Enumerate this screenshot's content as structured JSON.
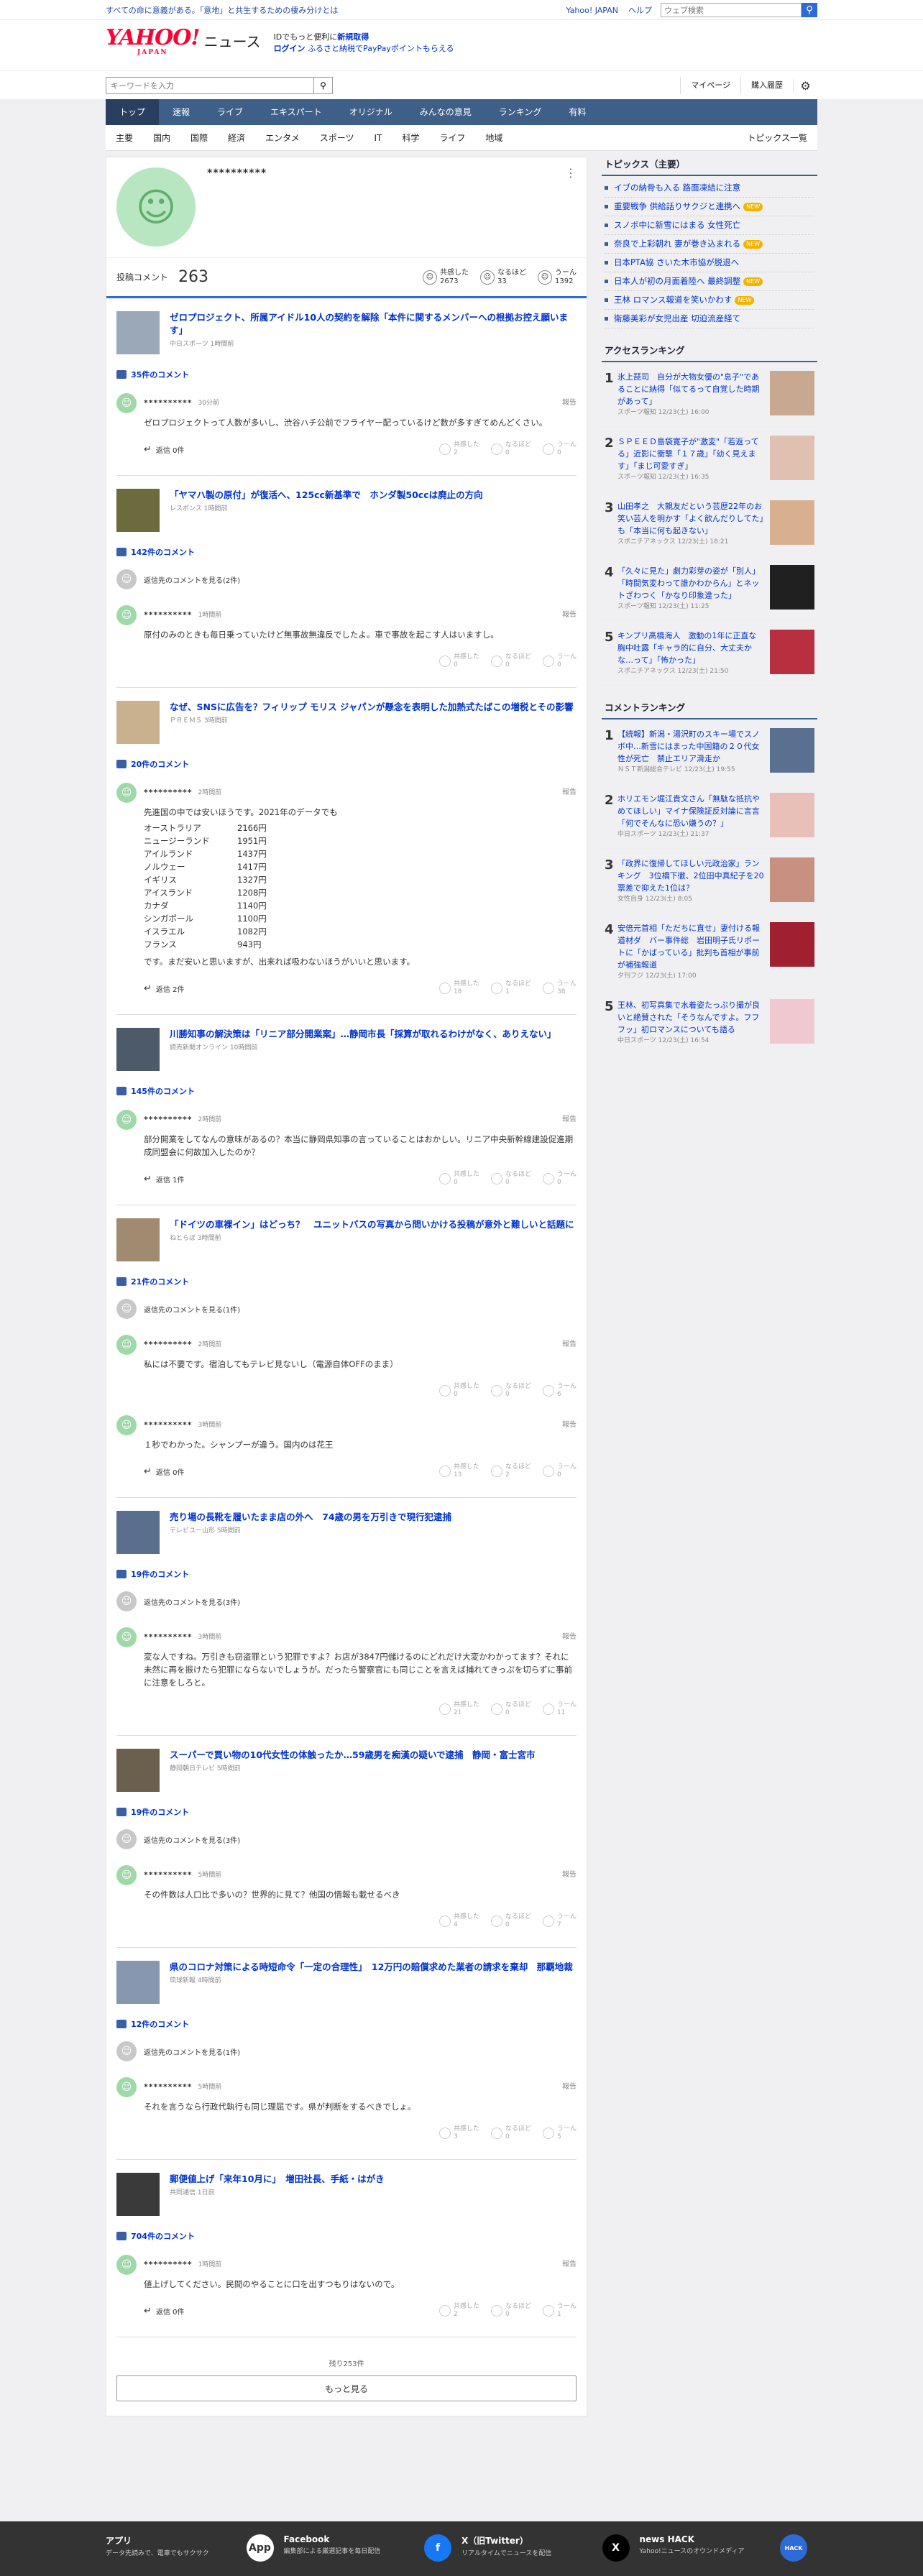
{
  "topbar": {
    "message": "すべての命に意義がある。「意地」と共生するための棲み分けとは",
    "yj": "Yahoo! JAPAN",
    "help": "ヘルプ",
    "search_placeholder": "ウェブ検索"
  },
  "header": {
    "logo": "YAHOO!",
    "logo_sub": "JAPAN",
    "service": "ニュース",
    "login_line1": "IDでもっと便利に",
    "signup": "新規取得",
    "login": "ログイン",
    "furusato": "ふるさと納税でPayPayポイントもらえる"
  },
  "searchbar": {
    "placeholder": "キーワードを入力",
    "mypage": "マイページ",
    "subscribe": "購入履歴"
  },
  "nav": [
    "トップ",
    "速報",
    "ライブ",
    "エキスパート",
    "オリジナル",
    "みんなの意見",
    "ランキング",
    "有料"
  ],
  "subnav": [
    "主要",
    "国内",
    "国際",
    "経済",
    "エンタメ",
    "スポーツ",
    "IT",
    "科学",
    "ライフ",
    "地域"
  ],
  "subnav_list": "トピックス一覧",
  "profile": {
    "name": "**********",
    "comments_label": "投稿コメント",
    "comments_count": "263",
    "stats": [
      {
        "label": "共感した",
        "value": "2673"
      },
      {
        "label": "なるほど",
        "value": "33"
      },
      {
        "label": "うーん",
        "value": "1392"
      }
    ]
  },
  "articles": [
    {
      "title": "ゼロプロジェクト、所属アイドル10人の契約を解除「本件に関するメンバーへの根拠お控え願います」",
      "source": "中日スポーツ 1時間前",
      "count": "35件のコメント",
      "comments": [
        {
          "user": "**********",
          "time": "30分前",
          "text": "ゼロプロジェクトって人数が多いし、渋谷ハチ公前でフライヤー配っているけど数が多すぎてめんどくさい。",
          "reply": "返信 0件",
          "r": [
            "2",
            "0",
            "0"
          ]
        }
      ]
    },
    {
      "title": "「ヤマハ製の原付」が復活へ、125cc新基準で　ホンダ製50ccは廃止の方向",
      "source": "レスポンス 1時間前",
      "count": "142件のコメント",
      "replies": "返信先のコメントを見る(2件)",
      "comments": [
        {
          "user": "**********",
          "time": "1時間前",
          "text": "原付のみのときも毎日乗っていたけど無事故無違反でしたよ。車で事故を起こす人はいますし。",
          "reply": "",
          "r": [
            "0",
            "0",
            "0"
          ]
        }
      ]
    },
    {
      "title": "なぜ、SNSに広告を？フィリップ モリス ジャパンが懸念を表明した加熱式たばこの増税とその影響",
      "source": "ＰＲＥＭＳ 3時間前",
      "count": "20件のコメント",
      "comments": [
        {
          "user": "**********",
          "time": "2時間前",
          "text": "先進国の中では安いほうです。2021年のデータでも",
          "table": [
            [
              "オーストラリア",
              "2166円"
            ],
            [
              "ニュージーランド",
              "1951円"
            ],
            [
              "アイルランド",
              "1437円"
            ],
            [
              "ノルウェー",
              "1417円"
            ],
            [
              "イギリス",
              "1327円"
            ],
            [
              "アイスランド",
              "1208円"
            ],
            [
              "カナダ",
              "1140円"
            ],
            [
              "シンガポール",
              "1100円"
            ],
            [
              "イスラエル",
              "1082円"
            ],
            [
              "フランス",
              "943円"
            ]
          ],
          "text2": "です。まだ安いと思いますが、出来れば吸わないほうがいいと思います。",
          "reply": "返信 2件",
          "r": [
            "18",
            "1",
            "38"
          ]
        }
      ]
    },
    {
      "title": "川勝知事の解決策は「リニア部分開業案」…静岡市長「採算が取れるわけがなく、ありえない」",
      "source": "読売新聞オンライン 10時間前",
      "count": "145件のコメント",
      "comments": [
        {
          "user": "**********",
          "time": "2時間前",
          "text": "部分開業をしてなんの意味があるの？本当に静岡県知事の言っていることはおかしい。リニア中央新幹線建設促進期成同盟会に何故加入したのか？",
          "reply": "返信 1件",
          "r": [
            "0",
            "0",
            "0"
          ]
        }
      ]
    },
    {
      "title": "「ドイツの車裸イン」はどっち？　ユニットバスの写真から問いかける投稿が意外と難しいと話題に",
      "source": "ねとらぼ 3時間前",
      "count": "21件のコメント",
      "replies": "返信先のコメントを見る(1件)",
      "comments": [
        {
          "user": "**********",
          "time": "2時間前",
          "text": "私には不要です。宿泊してもテレビ見ないし（電源自体OFFのまま）",
          "reply": "",
          "r": [
            "0",
            "0",
            "6"
          ]
        },
        {
          "user": "**********",
          "time": "3時間前",
          "text": "１秒でわかった。シャンプーが違う。国内のは花王",
          "reply": "返信 0件",
          "r": [
            "13",
            "2",
            "0"
          ]
        }
      ]
    },
    {
      "title": "売り場の長靴を履いたまま店の外へ　74歳の男を万引きで現行犯逮捕",
      "source": "テレビユー山形 5時間前",
      "count": "19件のコメント",
      "replies": "返信先のコメントを見る(3件)",
      "comments": [
        {
          "user": "**********",
          "time": "3時間前",
          "text": "変な人ですね。万引きも窃盗罪という犯罪ですよ？お店が3847円儲けるのにどれだけ大変かわかってます？それに未然に再を振けたら犯罪にならないでしょうが。だったら警察官にも同じことを言えば捕れてきっぷを切らずに事前に注意をしろと。",
          "reply": "",
          "r": [
            "21",
            "0",
            "11"
          ]
        }
      ]
    },
    {
      "title": "スーパーで買い物の10代女性の体触ったか…59歳男を痴漢の疑いで逮捕　静岡・富士宮市",
      "source": "静岡朝日テレビ 5時間前",
      "count": "19件のコメント",
      "replies": "返信先のコメントを見る(3件)",
      "comments": [
        {
          "user": "**********",
          "time": "5時間前",
          "text": "その件数は人口比で多いの？世界的に見て？他国の情報も載せるべき",
          "reply": "",
          "r": [
            "4",
            "0",
            "7"
          ]
        }
      ]
    },
    {
      "title": "県のコロナ対策による時短命令「一定の合理性」　12万円の賠償求めた業者の請求を棄却　那覇地裁",
      "source": "琉球新報 4時間前",
      "count": "12件のコメント",
      "replies": "返信先のコメントを見る(1件)",
      "comments": [
        {
          "user": "**********",
          "time": "5時間前",
          "text": "それを言うなら行政代執行も同じ理屈です。県が判断をするべきでしょ。",
          "reply": "",
          "r": [
            "3",
            "0",
            "5"
          ]
        }
      ]
    },
    {
      "title": "郵便値上げ「来年10月に」　増田社長、手紙・はがき",
      "source": "共同通信 1日前",
      "count": "704件のコメント",
      "comments": [
        {
          "user": "**********",
          "time": "1時間前",
          "text": "値上げしてください。民間のやることに口を出すつもりはないので。",
          "reply": "返信 0件",
          "r": [
            "2",
            "0",
            "1"
          ]
        }
      ]
    }
  ],
  "more": {
    "remaining": "残り253件",
    "button": "もっと見る"
  },
  "reaction_labels": [
    "共感した",
    "なるほど",
    "うーん"
  ],
  "report": "報告",
  "topics": {
    "title": "トピックス（主要）",
    "items": [
      {
        "t": "イブの納骨も入る 路面凍結に注意",
        "n": false
      },
      {
        "t": "重要戦争 供給話りサクジと連携へ",
        "n": true
      },
      {
        "t": "スノボ中に新雪にはまる 女性死亡",
        "n": false
      },
      {
        "t": "奈良で上彩朝れ 妻が巻き込まれる",
        "n": true
      },
      {
        "t": "日本PTA協 さいた木市協が脱退へ",
        "n": false
      },
      {
        "t": "日本人が初の月面着陸へ 最終調整",
        "n": true
      },
      {
        "t": "王林 ロマンス報道を笑いかわす",
        "n": true
      },
      {
        "t": "衛藤美彩が女児出産 切迫流産経て",
        "n": false
      }
    ]
  },
  "access_ranking": {
    "title": "アクセスランキング",
    "items": [
      {
        "t": "氷上琵司　自分が大物女優の\"息子\"であることに納得「似てるって自覚した時期があって」",
        "s": "スポーツ報知 12/23(土) 16:00"
      },
      {
        "t": "ＳＰＥＥＤ島袋寛子が\"激変\"「若返ってる」近影に衝撃「１７歳」「幼く見えます」「まじ可愛すぎ」",
        "s": "スポーツ報知 12/23(土) 16:35"
      },
      {
        "t": "山田孝之　大親友だという芸歴22年のお笑い芸人を明かす「よく飲んだりしてた」も「本当に何も起きない」",
        "s": "スポニチアネックス 12/23(土) 18:21"
      },
      {
        "t": "「久々に見た」劇力彩芽の姿が「別人」「時間気変わって誰かわからん」とネットざわつく「かなり印象違った」",
        "s": "スポーツ報知 12/23(土) 11:25"
      },
      {
        "t": "キンプリ髙橋海人　激動の1年に正直な胸中吐露「キャラ的に自分、大丈夫かな…って」「怖かった」",
        "s": "スポニチアネックス 12/23(土) 21:50"
      }
    ]
  },
  "comment_ranking": {
    "title": "コメントランキング",
    "items": [
      {
        "t": "【続報】新潟・湯沢町のスキー場でスノボ中…新雪にはまった中国籍の２０代女性が死亡　禁止エリア滑走か",
        "s": "ＮＳＴ新潟総合テレビ 12/23(土) 19:55"
      },
      {
        "t": "ホリエモン堀江貴文さん「無駄な抵抗やめてほしい」マイナ保険証反対論に言言「何でそんなに恐い嫌うの？」",
        "s": "中日スポーツ 12/23(土) 21:37"
      },
      {
        "t": "「政界に復帰してほしい元政治家」ランキング　3位橋下徹、2位田中真紀子を20票差で抑えた1位は？",
        "s": "女性自身 12/23(土) 8:05"
      },
      {
        "t": "安倍元首相「ただちに直せ」妻付ける報道材ダ　バー事件総　岩田明子氏リポートに「かばっている」批判も首相が事前が補強報道",
        "s": "夕刊フジ 12/23(土) 17:00"
      },
      {
        "t": "王林、初写真集で水着姿たっぷり撮が良いと絶賛された「そうなんですよ。フフフッ」初ロマンスについても語る",
        "s": "中日スポーツ 12/23(土) 16:54"
      }
    ]
  },
  "footer": [
    {
      "h": "アプリ",
      "s": "データ先読みで、電車でもサクサク",
      "ic": "App"
    },
    {
      "h": "Facebook",
      "s": "編集部による厳選記事を毎日配信",
      "ic": "f"
    },
    {
      "h": "X（旧Twitter）",
      "s": "リアルタイムでニュースを配信",
      "ic": "X"
    },
    {
      "h": "news HACK",
      "s": "Yahoo!ニュースのオウンドメディア",
      "ic": "HACK"
    }
  ]
}
